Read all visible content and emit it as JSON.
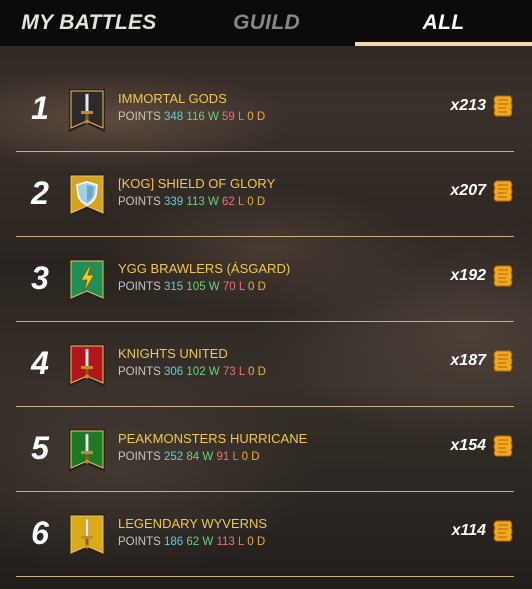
{
  "tabs": [
    {
      "label": "MY BATTLES"
    },
    {
      "label": "GUILD"
    },
    {
      "label": "ALL"
    }
  ],
  "stats_labels": {
    "points": "POINTS",
    "w": "W",
    "l": "L",
    "d": "D"
  },
  "rows": [
    {
      "rank": "1",
      "name": "IMMORTAL GODS",
      "points": "348",
      "wins": "116",
      "losses": "59",
      "draws": "0",
      "reward": "x213",
      "banner_color": "#2e2a2a",
      "banner_icon": "sword-icon"
    },
    {
      "rank": "2",
      "name": "[KOG] SHIELD OF GLORY",
      "points": "339",
      "wins": "113",
      "losses": "62",
      "draws": "0",
      "reward": "x207",
      "banner_color": "#d8a21f",
      "banner_icon": "shield-icon"
    },
    {
      "rank": "3",
      "name": "YGG BRAWLERS (ÁSGARD)",
      "points": "315",
      "wins": "105",
      "losses": "70",
      "draws": "0",
      "reward": "x192",
      "banner_color": "#1f8f56",
      "banner_icon": "lightning-icon"
    },
    {
      "rank": "4",
      "name": "KNIGHTS UNITED",
      "points": "306",
      "wins": "102",
      "losses": "73",
      "draws": "0",
      "reward": "x187",
      "banner_color": "#b1171a",
      "banner_icon": "sword-icon"
    },
    {
      "rank": "5",
      "name": "PEAKMONSTERS HURRICANE",
      "points": "252",
      "wins": "84",
      "losses": "91",
      "draws": "0",
      "reward": "x154",
      "banner_color": "#1d7a22",
      "banner_icon": "sword-icon"
    },
    {
      "rank": "6",
      "name": "LEGENDARY WYVERNS",
      "points": "186",
      "wins": "62",
      "losses": "113",
      "draws": "0",
      "reward": "x114",
      "banner_color": "#d9ab14",
      "banner_icon": "sword-icon"
    }
  ],
  "reward_icon": "merit-scroll-icon",
  "colors": {
    "accent_underline": "#f3d9a2",
    "name": "#f1c84d",
    "points": "#5fd0d8",
    "wins": "#66d47a",
    "losses": "#ee6f78",
    "draws": "#e9b03f"
  }
}
